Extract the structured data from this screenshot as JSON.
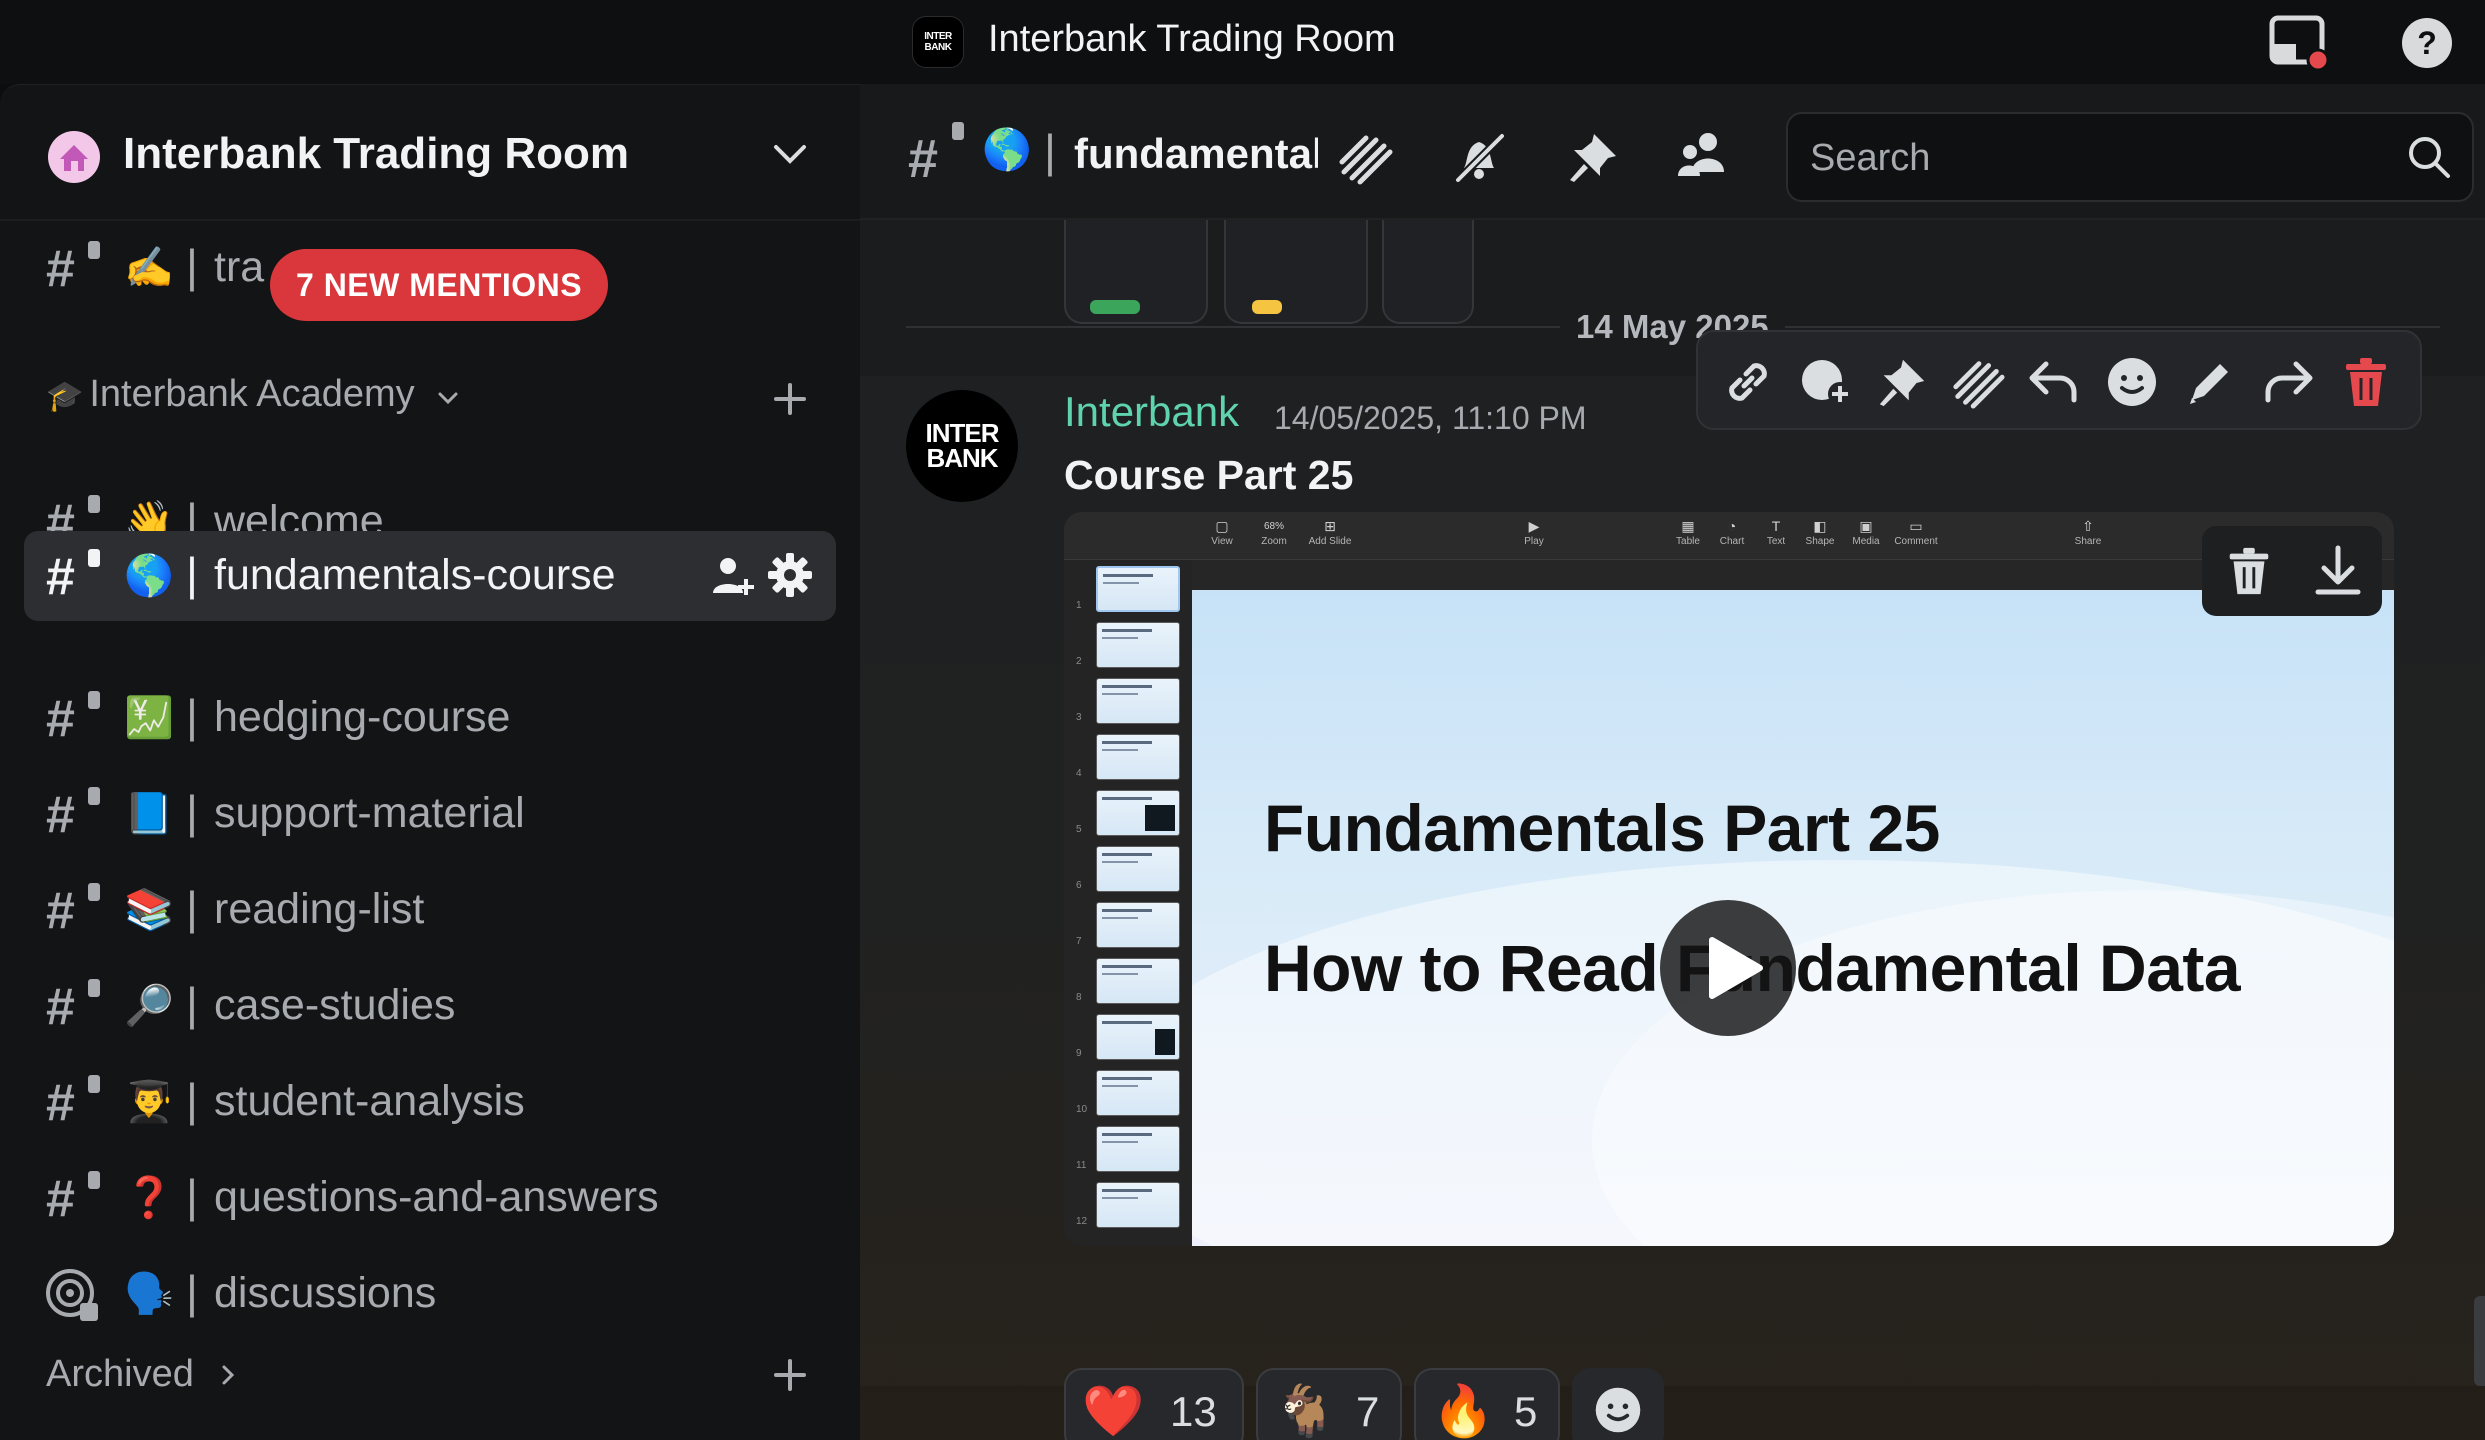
{
  "window": {
    "title": "Interbank Trading Room",
    "logo_line1": "INTER",
    "logo_line2": "BANK"
  },
  "server": {
    "name": "Interbank Trading Room",
    "mentions_badge": "7 NEW MENTIONS",
    "top_channel": {
      "emoji": "✍️",
      "name": "tra"
    },
    "category": {
      "icon": "🎓",
      "name": "Interbank Academy"
    },
    "channels": [
      {
        "emoji": "👋",
        "name": "welcome"
      },
      {
        "emoji": "🌎",
        "name": "fundamentals-course",
        "active": true
      },
      {
        "emoji": "💹",
        "name": "hedging-course"
      },
      {
        "emoji": "📘",
        "name": "support-material"
      },
      {
        "emoji": "📚",
        "name": "reading-list"
      },
      {
        "emoji": "🔎",
        "name": "case-studies"
      },
      {
        "emoji": "👨‍🎓",
        "name": "student-analysis"
      },
      {
        "emoji": "❓",
        "name": "questions-and-answers"
      },
      {
        "emoji": "🗣️",
        "name": "discussions",
        "type": "forum"
      }
    ],
    "archived_label": "Archived"
  },
  "channel_header": {
    "emoji": "🌎",
    "name": "fundamentals-course",
    "search_placeholder": "Search"
  },
  "messages": {
    "date_divider": "14 May 2025",
    "author": "Interbank",
    "avatar_line1": "INTER",
    "avatar_line2": "BANK",
    "timestamp": "14/05/2025, 11:10 PM",
    "text": "Course Part 25",
    "attachment": {
      "toolbar": [
        "View",
        "Zoom",
        "Add Slide",
        "Play",
        "Table",
        "Chart",
        "Text",
        "Shape",
        "Media",
        "Comment",
        "Share"
      ],
      "zoom": "68%",
      "slide_title": "Fundamentals Part 25",
      "slide_subtitle": "How to Read Fundamental Data",
      "slide_numbers": [
        "1",
        "2",
        "3",
        "4",
        "5",
        "6",
        "7",
        "8",
        "9",
        "10",
        "11",
        "12"
      ]
    },
    "reactions": [
      {
        "emoji": "❤️",
        "count": "13"
      },
      {
        "emoji": "🐐",
        "count": "7"
      },
      {
        "emoji": "🔥",
        "count": "5"
      }
    ]
  },
  "colors": {
    "accent_author": "#5fd3b0",
    "mentions": "#da373c",
    "delete": "#e5484d"
  }
}
